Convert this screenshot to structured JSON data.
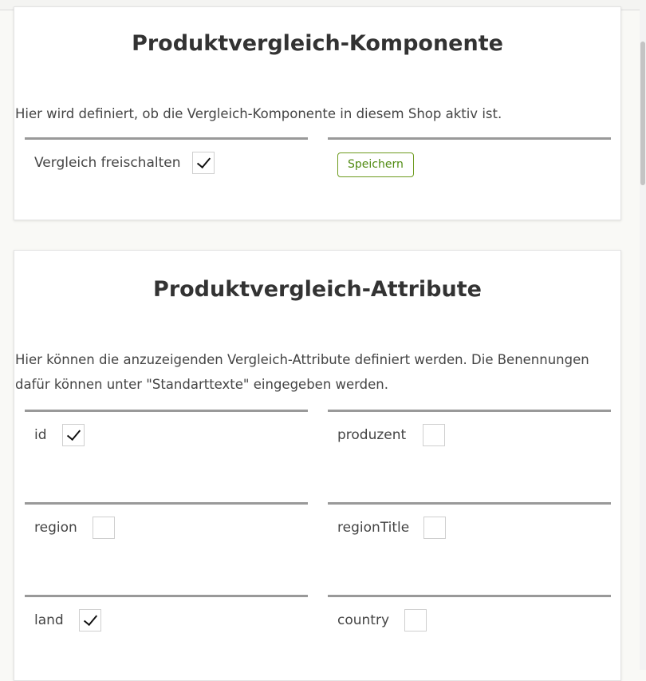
{
  "compare_component": {
    "title": "Produktvergleich-Komponente",
    "description": "Hier wird definiert, ob die Vergleich-Komponente in diesem Shop aktiv ist.",
    "enable_label": "Vergleich freischalten",
    "enable_checked": true,
    "save_label": "Speichern"
  },
  "compare_attributes": {
    "title": "Produktvergleich-Attribute",
    "description": "Hier können die anzuzeigenden Vergleich-Attribute definiert werden. Die Benennungen dafür können unter \"Standarttexte\" eingegeben werden.",
    "attributes": [
      {
        "label": "id",
        "checked": true
      },
      {
        "label": "produzent",
        "checked": false
      },
      {
        "label": "region",
        "checked": false
      },
      {
        "label": "regionTitle",
        "checked": false
      },
      {
        "label": "land",
        "checked": true
      },
      {
        "label": "country",
        "checked": false
      }
    ]
  },
  "colors": {
    "accent_green": "#4f8a10",
    "divider": "#999999",
    "card_background": "#ffffff",
    "page_background": "#f9f9f6"
  },
  "icons": {
    "checked": "checkmark-icon"
  }
}
